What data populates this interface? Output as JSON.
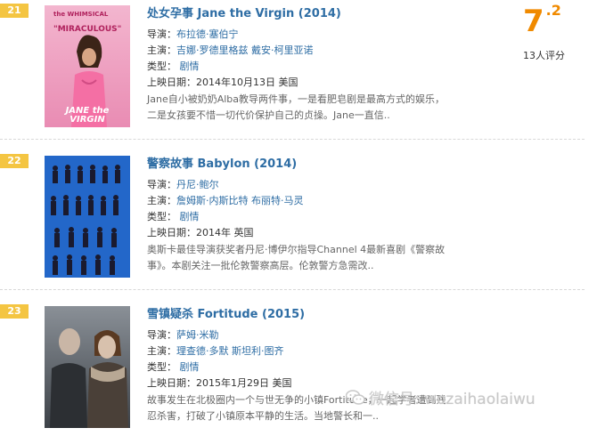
{
  "labels": {
    "director": "导演：",
    "cast": "主演：",
    "genre": "类型：",
    "release": "上映日期："
  },
  "entries": [
    {
      "rank": "21",
      "title": "处女孕事 Jane the Virgin (2014)",
      "director": "布拉德·塞伯宁",
      "cast": [
        "吉娜·罗德里格兹",
        "戴安·柯里亚诺"
      ],
      "genre": "剧情",
      "release": "2014年10月13日 美国",
      "description": "Jane自小被奶奶Alba教导两件事，一是看肥皂剧是最高方式的娱乐，二是女孩要不惜一切代价保护自己的贞操。Jane一直信..",
      "poster_text": [
        "the WHIMSICAL",
        "\"MIRACULOUS\"",
        "JANE the VIRGIN"
      ],
      "rating_int": "7",
      "rating_dec": ".2",
      "votes": "13人评分"
    },
    {
      "rank": "22",
      "title": "警察故事 Babylon (2014)",
      "director": "丹尼·鲍尔",
      "cast": [
        "詹姆斯·内斯比特",
        "布丽特·马灵"
      ],
      "genre": "剧情",
      "release": "2014年 英国",
      "description": "奥斯卡最佳导演获奖者丹尼·博伊尔指导Channel 4最新喜剧《警察故事》。本剧关注一批伦敦警察高层。伦敦警方急需改.."
    },
    {
      "rank": "23",
      "title": "雪镇疑杀 Fortitude (2015)",
      "director": "萨姆·米勒",
      "cast": [
        "理查德·多默",
        "斯坦利·图齐"
      ],
      "genre": "剧情",
      "release": "2015年1月29日 美国",
      "description": "故事发生在北极圈内一个与世无争的小镇Fortitude，一起学者遭到残忍杀害，打破了小镇原本平静的生活。当地警长和一.."
    }
  ],
  "watermark": "微信号: wozaihaolaiwu"
}
